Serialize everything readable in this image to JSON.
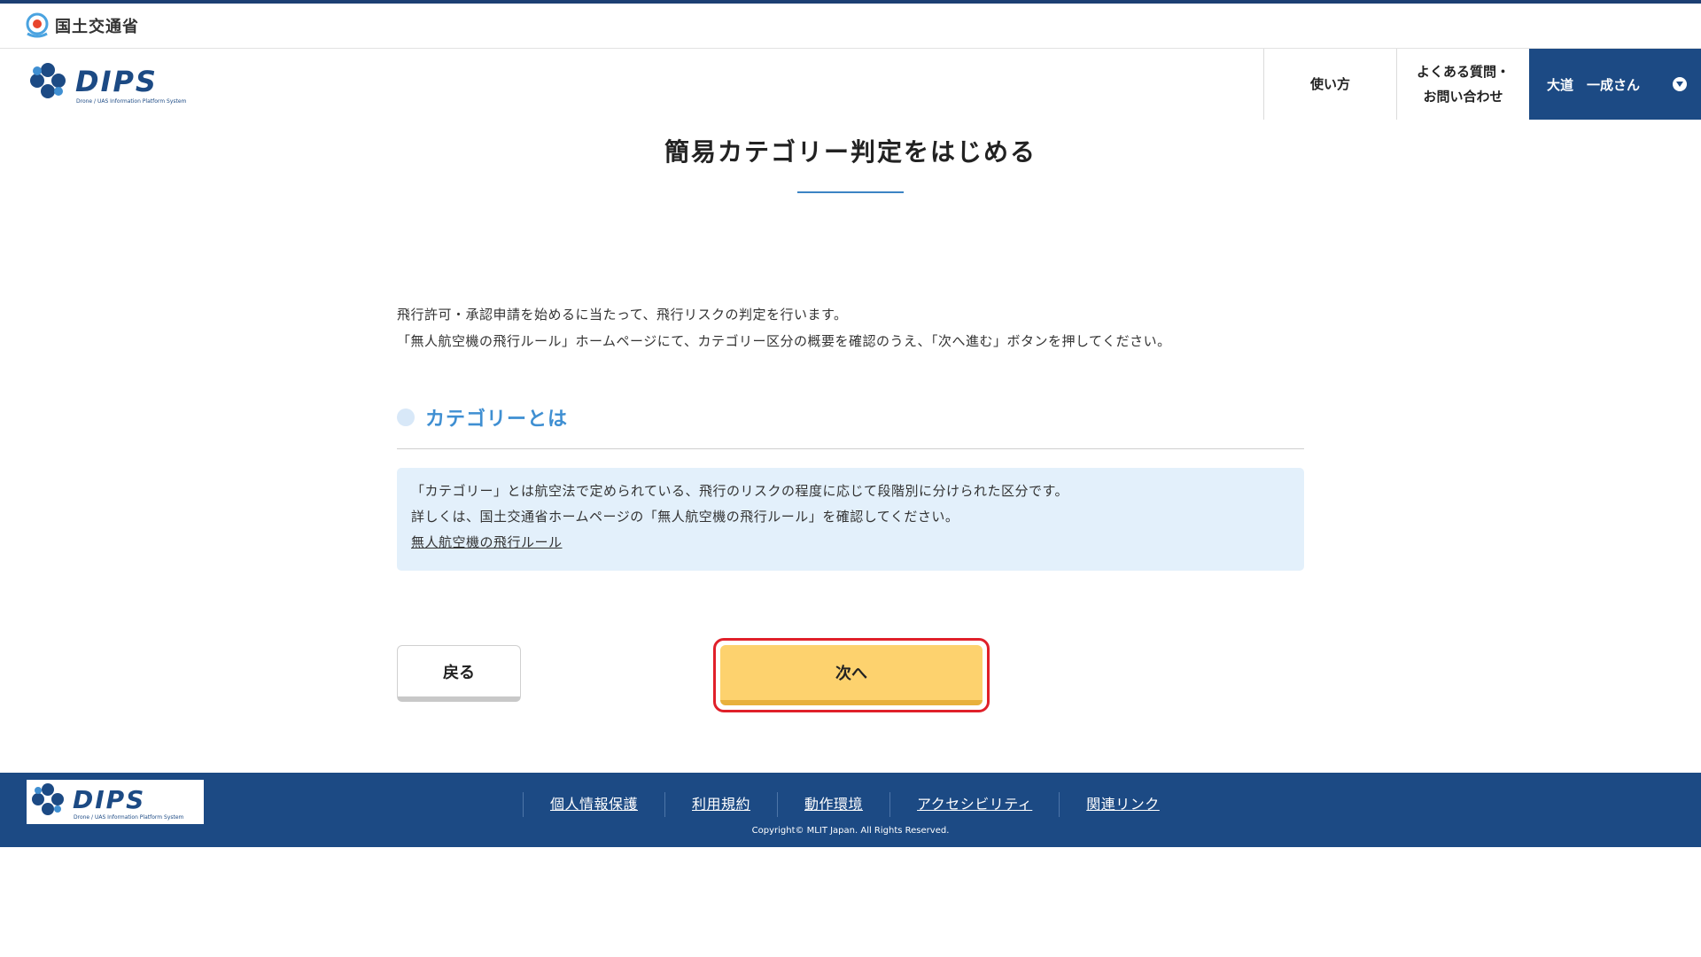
{
  "ministry": {
    "name": "国土交通省"
  },
  "brand": {
    "logo_text": "DIPS",
    "tagline": "Drone / UAS Information Platform System"
  },
  "nav": {
    "usage": "使い方",
    "faq_line1": "よくある質問・",
    "faq_line2": "お問い合わせ",
    "user": "大道　一成さん"
  },
  "main": {
    "title": "簡易カテゴリー判定をはじめる",
    "intro_line1": "飛行許可・承認申請を始めるに当たって、飛行リスクの判定を行います。",
    "intro_line2": "「無人航空機の飛行ルール」ホームページにて、カテゴリー区分の概要を確認のうえ、「次へ進む」ボタンを押してください。",
    "section_title": "カテゴリーとは",
    "info_line1": "「カテゴリー」とは航空法で定められている、飛行のリスクの程度に応じて段階別に分けられた区分です。",
    "info_line2": "詳しくは、国土交通省ホームページの「無人航空機の飛行ルール」を確認してください。",
    "info_link": "無人航空機の飛行ルール"
  },
  "buttons": {
    "back": "戻る",
    "next": "次へ"
  },
  "footer": {
    "links": [
      "個人情報保護",
      "利用規約",
      "動作環境",
      "アクセシビリティ",
      "関連リンク"
    ],
    "copyright": "Copyright© MLIT Japan. All Rights Reserved."
  },
  "colors": {
    "primary": "#1c4a84",
    "accent": "#3f8fd2",
    "next_button": "#fdd26e",
    "highlight_border": "#e0202a"
  }
}
